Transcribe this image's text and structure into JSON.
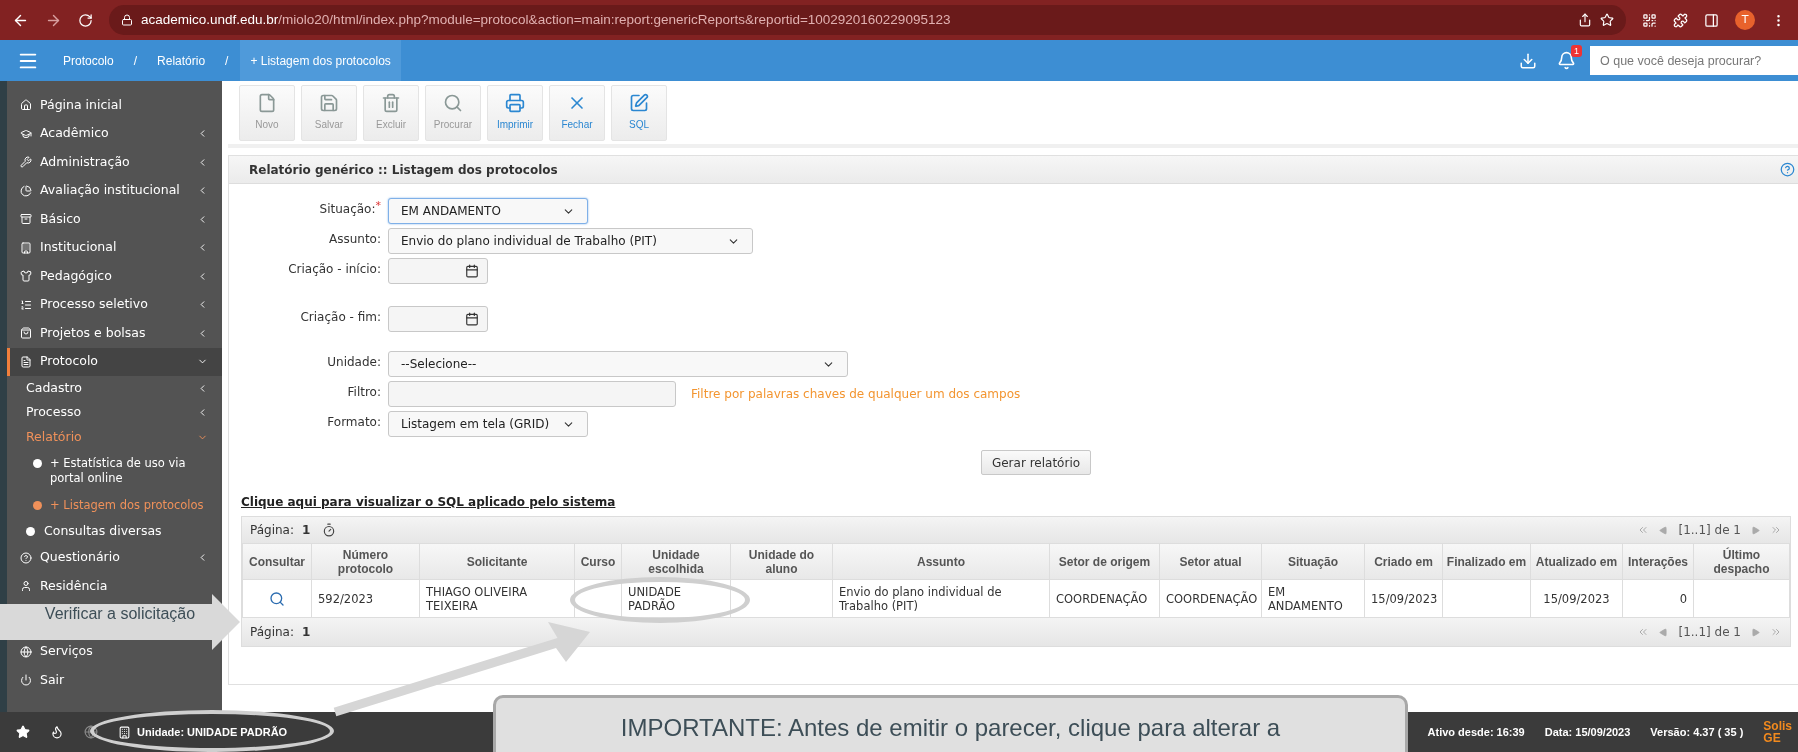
{
  "browser": {
    "url_host": "academico.undf.edu.br",
    "url_path": "/miolo20/html/index.php?module=protocol&action=main:report:genericReports&reportid=1002920160229095123",
    "avatar": "T"
  },
  "appbar": {
    "breadcrumbs": [
      {
        "label": "Protocolo",
        "selected": false
      },
      {
        "label": "Relatório",
        "selected": false
      },
      {
        "label": "+ Listagem dos protocolos",
        "selected": true
      }
    ],
    "separator": "/",
    "notifications": "1",
    "search_placeholder": "O que você deseja procurar?"
  },
  "sidebar": [
    {
      "kind": "link",
      "label": "Página inicial",
      "selected": false
    },
    {
      "kind": "menu",
      "label": "Acadêmico",
      "expanded": false,
      "selected": false
    },
    {
      "kind": "menu",
      "label": "Administração",
      "expanded": false,
      "selected": false
    },
    {
      "kind": "menu",
      "label": "Avaliação institucional",
      "expanded": false,
      "selected": false
    },
    {
      "kind": "menu",
      "label": "Básico",
      "expanded": false,
      "selected": false
    },
    {
      "kind": "menu",
      "label": "Institucional",
      "expanded": false,
      "selected": false
    },
    {
      "kind": "menu",
      "label": "Pedagógico",
      "expanded": false,
      "selected": false
    },
    {
      "kind": "menu",
      "label": "Processo seletivo",
      "expanded": false,
      "selected": false
    },
    {
      "kind": "menu",
      "label": "Projetos e bolsas",
      "expanded": false,
      "selected": false
    },
    {
      "kind": "menu",
      "label": "Protocolo",
      "expanded": true,
      "selected": true
    },
    {
      "kind": "sub",
      "label": "Cadastro",
      "expanded": false,
      "selected": false
    },
    {
      "kind": "sub",
      "label": "Processo",
      "expanded": false,
      "selected": false
    },
    {
      "kind": "sub",
      "label": "Relatório",
      "expanded": true,
      "selected": true
    },
    {
      "kind": "leaf",
      "label": "+ Estatística de uso via portal online",
      "selected": false
    },
    {
      "kind": "leaf",
      "label": "+ Listagem dos protocolos",
      "selected": true
    },
    {
      "kind": "bullet",
      "label": "Consultas diversas",
      "selected": false
    },
    {
      "kind": "menu",
      "label": "Questionário",
      "expanded": false,
      "selected": false
    },
    {
      "kind": "link",
      "label": "Residência",
      "selected": false
    },
    {
      "kind": "link",
      "label": "Serviços",
      "selected": false
    },
    {
      "kind": "link",
      "label": "Sair",
      "selected": false
    }
  ],
  "toolbar": [
    {
      "label": "Novo",
      "disabled": true
    },
    {
      "label": "Salvar",
      "disabled": true
    },
    {
      "label": "Excluir",
      "disabled": true
    },
    {
      "label": "Procurar",
      "disabled": true
    },
    {
      "label": "Imprimir",
      "disabled": false
    },
    {
      "label": "Fechar",
      "disabled": false
    },
    {
      "label": "SQL",
      "disabled": false
    }
  ],
  "panel_title": "Relatório genérico :: Listagem dos protocolos",
  "form": [
    {
      "kind": "select",
      "label": "Situação:",
      "required_mark": "*",
      "value": "EM ANDAMENTO"
    },
    {
      "kind": "select",
      "label": "Assunto:",
      "value": "Envio do plano individual de Trabalho (PIT)"
    },
    {
      "kind": "date",
      "label": "Criação - início:"
    },
    {
      "kind": "date",
      "label": "Criação - fim:"
    },
    {
      "kind": "select",
      "label": "Unidade:",
      "value": "--Selecione--"
    },
    {
      "kind": "text",
      "label": "Filtro:",
      "hint": "Filtre por palavras chaves de qualquer um dos campos"
    },
    {
      "kind": "select",
      "label": "Formato:",
      "value": "Listagem em tela (GRID)"
    }
  ],
  "generate_button": "Gerar relatório",
  "sql_link": "Clique aqui para visualizar o SQL aplicado pelo sistema",
  "table": {
    "top_bar": {
      "page_label": "Página:",
      "page": "1",
      "pager": "[1..1] de 1"
    },
    "columns": [
      "Consultar",
      "Número protocolo",
      "Solicitante",
      "Curso",
      "Unidade escolhida",
      "Unidade do aluno",
      "Assunto",
      "Setor de origem",
      "Setor atual",
      "Situação",
      "Criado em",
      "Finalizado em",
      "Atualizado em",
      "Interações",
      "Último despacho"
    ],
    "rows": [
      [
        "",
        "592/2023",
        "THIAGO OLIVEIRA TEIXEIRA",
        "",
        "UNIDADE PADRÃO",
        "",
        "Envio do plano individual de Trabalho (PIT)",
        "COORDENAÇÃO",
        "COORDENAÇÃO",
        "EM ANDAMENTO",
        "15/09/2023",
        "",
        "15/09/2023",
        "0",
        ""
      ]
    ],
    "bottom_bar": {
      "page_label": "Página:",
      "page": "1",
      "pager": "[1..1] de 1"
    }
  },
  "status_bar": {
    "unit": "Unidade: UNIDADE PADRÃO",
    "active_since": "Ativo desde: 16:39",
    "date": "Data: 15/09/2023",
    "version": "Versão: 4.37 ( 35 )",
    "logo": [
      "Solis",
      "GE"
    ]
  },
  "annotations": {
    "arrow_label": "Verificar a solicitação",
    "callout": "IMPORTANTE: Antes de emitir o parecer, clique para alterar a"
  }
}
